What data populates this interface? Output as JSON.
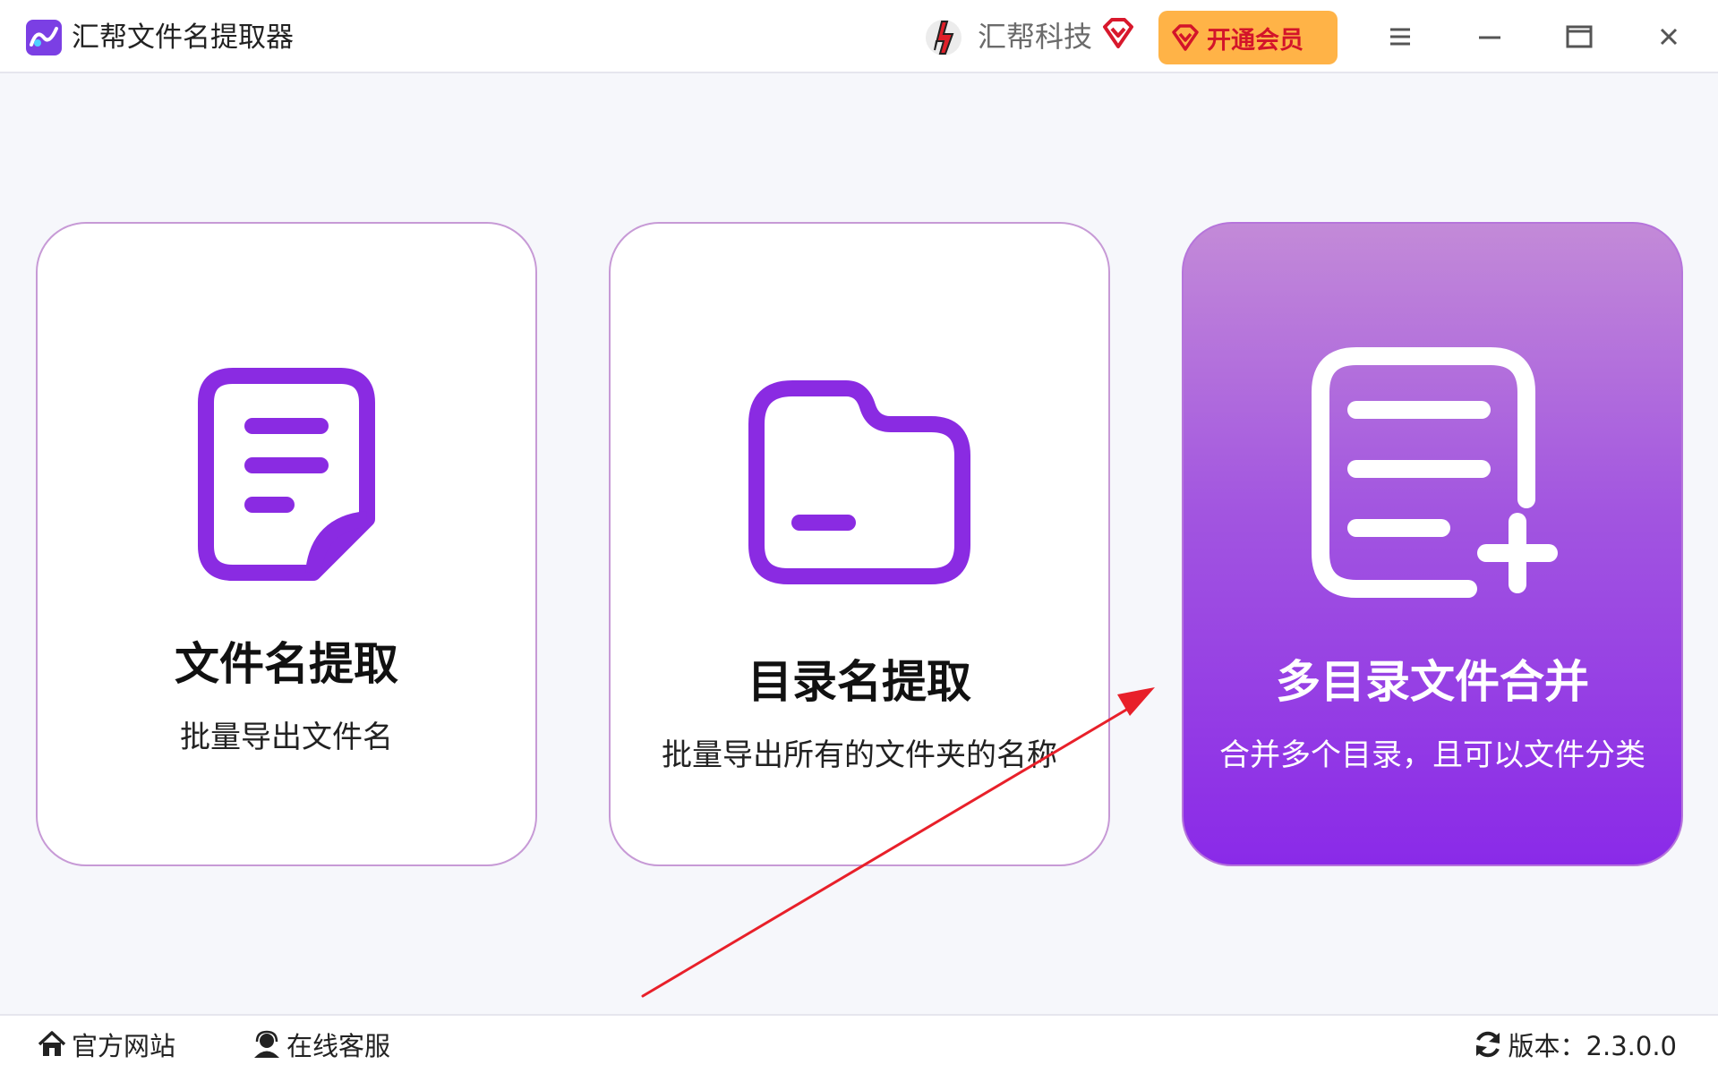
{
  "app": {
    "title": "汇帮文件名提取器",
    "brand_name": "汇帮科技",
    "vip_button_label": "开通会员"
  },
  "window_controls": [
    {
      "name": "menu-icon"
    },
    {
      "name": "minimize-icon"
    },
    {
      "name": "maximize-icon"
    },
    {
      "name": "close-icon"
    }
  ],
  "cards": [
    {
      "id": "file-name",
      "title": "文件名提取",
      "desc": "批量导出文件名",
      "icon": "document-icon",
      "active": false
    },
    {
      "id": "dir-name",
      "title": "目录名提取",
      "desc": "批量导出所有的文件夹的名称",
      "icon": "folder-icon",
      "active": false
    },
    {
      "id": "merge",
      "title": "多目录文件合并",
      "desc": "合并多个目录，且可以文件分类",
      "icon": "list-add-icon",
      "active": true
    }
  ],
  "footer": {
    "website_label": "官方网站",
    "support_label": "在线客服",
    "version_label": "版本：2.3.0.0"
  },
  "colors": {
    "accent": "#8a2be2",
    "vip_bg": "#ffb347",
    "vip_text": "#d3142a",
    "arrow": "#e8202a"
  }
}
